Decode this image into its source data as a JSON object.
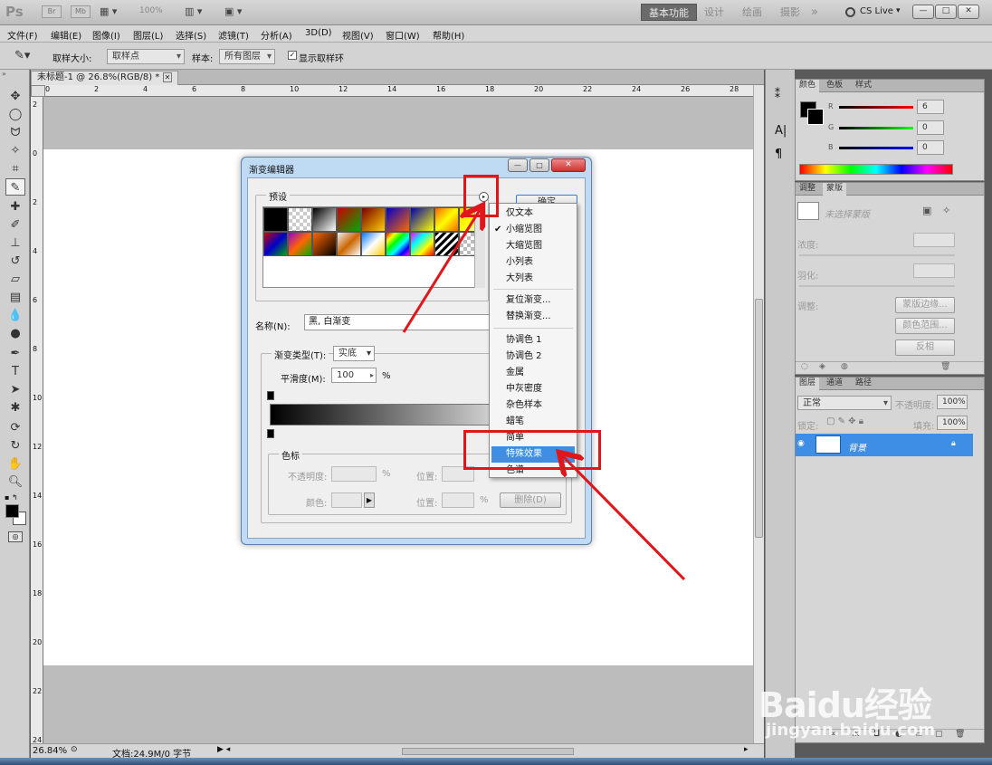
{
  "app": {
    "logo": "Ps",
    "top_icons": [
      "Br",
      "Mb"
    ],
    "zoom_value": "100%",
    "workspaces": [
      "基本功能",
      "设计",
      "绘画",
      "摄影"
    ],
    "more": "»",
    "cslive": "CS Live",
    "window_controls": [
      "—",
      "□",
      "✕"
    ]
  },
  "menu": [
    "文件(F)",
    "编辑(E)",
    "图像(I)",
    "图层(L)",
    "选择(S)",
    "滤镜(T)",
    "分析(A)",
    "3D(D)",
    "视图(V)",
    "窗口(W)",
    "帮助(H)"
  ],
  "options": {
    "sample_size_label": "取样大小:",
    "sample_size_value": "取样点",
    "sample_label": "样本:",
    "sample_value": "所有图层",
    "show_ring_label": "显示取样环",
    "show_ring_checked": true
  },
  "document": {
    "tab_title": "未标题-1 @ 26.8%(RGB/8) *",
    "close": "✕",
    "ruler_h": [
      "0",
      "2",
      "4",
      "6",
      "8",
      "10",
      "12",
      "14",
      "16",
      "18",
      "20",
      "22",
      "24",
      "26",
      "28"
    ],
    "ruler_v": [
      "2",
      "0",
      "2",
      "4",
      "6",
      "8",
      "10",
      "12",
      "14",
      "16",
      "18",
      "20",
      "22",
      "24"
    ]
  },
  "status": {
    "zoom": "26.84%",
    "doc_info": "文档:24.9M/0 字节"
  },
  "color_panel": {
    "tabs": [
      "颜色",
      "色板",
      "样式"
    ],
    "channels": [
      {
        "label": "R",
        "value": "6",
        "color": "#e02020"
      },
      {
        "label": "G",
        "value": "0",
        "color": "#20b020"
      },
      {
        "label": "B",
        "value": "0",
        "color": "#2030e0"
      }
    ]
  },
  "adjust_panel": {
    "tabs": [
      "调整",
      "蒙版"
    ],
    "no_mask": "未选择蒙版",
    "density_label": "浓度:",
    "feather_label": "羽化:",
    "refine_label": "调整:",
    "buttons": [
      "蒙版边缘...",
      "颜色范围...",
      "反相"
    ]
  },
  "layers_panel": {
    "tabs": [
      "图层",
      "通道",
      "路径"
    ],
    "blend_mode": "正常",
    "opacity_label": "不透明度:",
    "opacity_value": "100%",
    "lock_label": "锁定:",
    "fill_label": "填充:",
    "fill_value": "100%",
    "layer_name": "背景"
  },
  "dialog": {
    "title": "渐变编辑器",
    "controls": [
      "—",
      "□",
      "✕"
    ],
    "presets_label": "预设",
    "ok": "确定",
    "name_label": "名称(N):",
    "name_value": "黑, 白渐变",
    "type_label": "渐变类型(T):",
    "type_value": "实底",
    "smooth_label": "平滑度(M):",
    "smooth_value": "100",
    "percent": "%",
    "stops_label": "色标",
    "opacity_label": "不透明度:",
    "position_label": "位置:",
    "color_label": "颜色:",
    "delete": "删除(D)",
    "preset_swatches": [
      "linear-gradient(135deg,#000,#000)",
      "repeating-conic-gradient(#ccc 0 25%,#fff 0 50%) 0 0/8px 8px",
      "linear-gradient(135deg,#000,#fff)",
      "linear-gradient(135deg,#c00,#0a0)",
      "linear-gradient(135deg,#700,#fc0)",
      "linear-gradient(135deg,#00c,#f60)",
      "linear-gradient(135deg,#00a,#ff0)",
      "linear-gradient(135deg,#f60,#ff0,#f60)",
      "linear-gradient(135deg,#fc0,#ff0,transparent)",
      "linear-gradient(135deg,#c00,#00c,#0a0)",
      "linear-gradient(135deg,#90c,#f60,#0a0)",
      "linear-gradient(135deg,#f60,#000)",
      "linear-gradient(135deg,#eee,#c60,#fff)",
      "linear-gradient(135deg,#07f,#fff,#fc0)",
      "linear-gradient(135deg,#f00,#ff0,#0f0,#0ff,#00f,#f0f)",
      "linear-gradient(135deg,#f0f,#0ff,#ff0,#f00)",
      "repeating-linear-gradient(135deg,#000 0 3px,#fff 3px 6px)",
      "repeating-conic-gradient(#bbb 0 25%,#fff 0 50%) 0 0/8px 8px"
    ]
  },
  "context_menu": {
    "items": [
      "仅文本",
      "小缩览图",
      "大缩览图",
      "小列表",
      "大列表",
      "复位渐变...",
      "替换渐变...",
      "协调色 1",
      "协调色 2",
      "金属",
      "中灰密度",
      "杂色样本",
      "蜡笔",
      "简单",
      "特殊效果",
      "色谱"
    ],
    "checked": "小缩览图",
    "highlighted": "特殊效果"
  },
  "watermark": {
    "brand": "Baidu经验",
    "url": "jingyan.baidu.com"
  },
  "colors": {
    "highlight": "#3d8ee4",
    "annotation": "#e0161b",
    "layer_selected": "#3d8ee4"
  }
}
